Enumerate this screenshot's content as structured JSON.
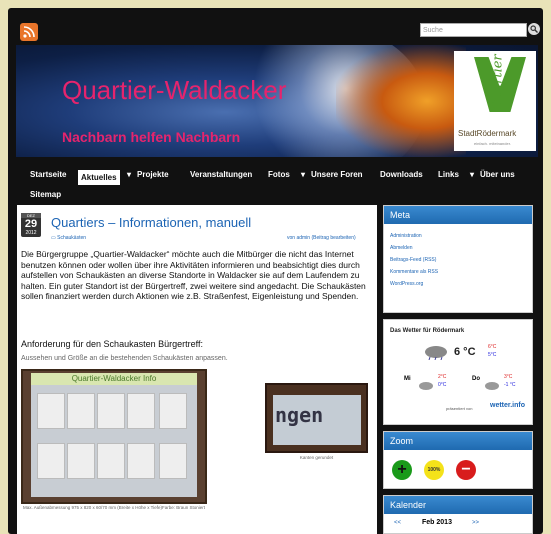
{
  "search": {
    "placeholder": "Suche"
  },
  "header": {
    "title": "Quartier-Waldacker",
    "tagline": "Nachbarn helfen Nachbarn",
    "logo_text": "Quartier",
    "logo_city": "StadtRödermark",
    "logo_slogan": "einfach. miteinander."
  },
  "nav": {
    "items": [
      "Startseite",
      "Aktuelles",
      "Projekte",
      "Veranstaltungen",
      "Fotos",
      "Unsere Foren",
      "Downloads",
      "Links",
      "Über uns",
      "Sitemap"
    ]
  },
  "post": {
    "date": {
      "month": "DEZ",
      "day": "29",
      "year": "2012"
    },
    "title": "Quartiers – Informationen, manuell",
    "category": "Schaukästen",
    "meta": "von admin  (Beitrag bearbeiten)",
    "body": "Die Bürgergruppe „Quartier-Waldacker“ möchte auch die Mitbürger die nicht das Internet benutzen können oder wollen über ihre Aktivitäten informieren und beabsichtigt dies durch aufstellen von Schaukästen an diverse Standorte in Waldacker sie auf dem Laufendem zu halten. Ein guter Standort ist der Bürgertreff, zwei weitere sind angedacht. Die Schaukästen sollen finanziert werden durch Aktionen wie z.B. Straßenfest, Eigenleistung und Spenden.",
    "heading": "Anforderung für den Schaukasten Bürgertreff:",
    "subtext": "Aussehen und Größe an die bestehenden Schaukästen anpassen.",
    "img1_header": "Quartier-Waldacker Info",
    "img1_caption": "Max. Außenabmessung 975 x 820 x 60/70 mm (Breite x Höhe x Tiefe)Farbe: Braun Stoniert",
    "img2_text": "ngen",
    "img2_caption": "Kanten gerundet"
  },
  "sidebar": {
    "meta": {
      "title": "Meta",
      "links": [
        "Administration",
        "Abmelden",
        "Beitrags-Feed (RSS)",
        "Kommentare als RSS",
        "WordPress.org"
      ]
    },
    "weather": {
      "title": "Das Wetter für Rödermark",
      "temp": "6 °C",
      "hi": "6°C",
      "lo": "5°C",
      "days": [
        {
          "name": "Mi",
          "hi": "2°C",
          "lo": "0°C"
        },
        {
          "name": "Do",
          "hi": "3°C",
          "lo": "-1 °C"
        }
      ],
      "credit": "präsentiert von",
      "brand": "wetter.info"
    },
    "zoom": {
      "title": "Zoom",
      "labels": [
        "+",
        "100%",
        "−"
      ]
    },
    "calendar": {
      "title": "Kalender",
      "month": "Feb 2013",
      "prev": "<<",
      "next": ">>"
    }
  },
  "colors": {
    "accent": "#e6246d",
    "link": "#1c64b4",
    "widget_header": "#2a7bc4"
  }
}
